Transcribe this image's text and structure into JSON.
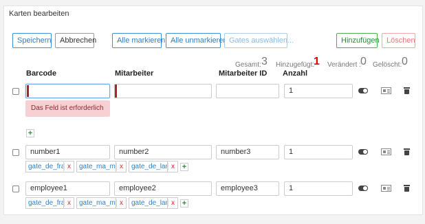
{
  "header": {
    "title": "Karten bearbeiten"
  },
  "toolbar": {
    "save": "Speichern",
    "cancel": "Abbrechen",
    "select_all": "Alle markieren",
    "deselect_all": "Alle unmarkieren",
    "select_gates": "Gates auswählen...",
    "add": "Hinzufügen",
    "delete": "Löschen"
  },
  "stats": {
    "total_label": "Gesamt:",
    "total_value": "3",
    "added_label": "Hinzugefügt:",
    "added_value": "1",
    "changed_label": "Verändert :",
    "changed_value": "0",
    "deleted_label": "Gelöscht:",
    "deleted_value": "0"
  },
  "columns": {
    "barcode": "Barcode",
    "employee": "Mitarbeiter",
    "employee_id": "Mitarbeiter ID",
    "count": "Anzahl"
  },
  "rows": [
    {
      "barcode": "",
      "employee": "",
      "employee_id": "",
      "count": "1",
      "error": "Das Feld ist erforderlich",
      "tags": []
    },
    {
      "barcode": "number1",
      "employee": "number2",
      "employee_id": "number3",
      "count": "1",
      "tags": [
        "gate_de_fra",
        "gate_ma_mar",
        "gate_de_lan"
      ]
    },
    {
      "barcode": "employee1",
      "employee": "employee2",
      "employee_id": "employee3",
      "count": "1",
      "tags": [
        "gate_de_fra",
        "gate_ma_mar",
        "gate_de_lan"
      ]
    }
  ],
  "glyphs": {
    "plus": "+",
    "remove": "x"
  },
  "icons": [
    "toggle-icon",
    "id-card-icon",
    "trash-icon",
    "plus-icon"
  ]
}
